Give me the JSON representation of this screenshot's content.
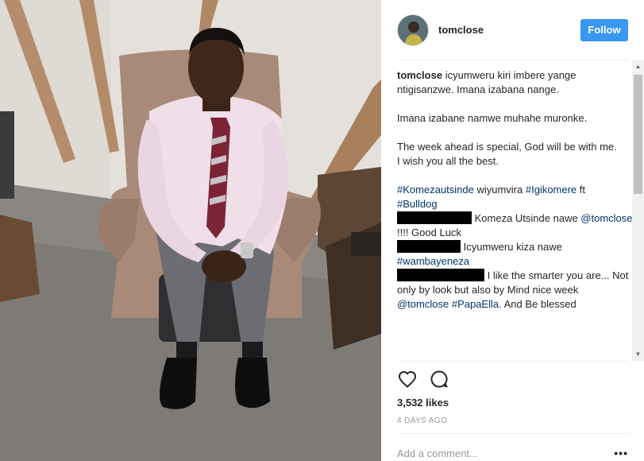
{
  "post": {
    "username": "tomclose",
    "follow_label": "Follow",
    "caption": {
      "lines": [
        "icyumweru kiri imbere yange ntigisanzwe. Imana izabana nange.",
        "Imana izabane namwe muhahe muronke.",
        "The week ahead is special, God will be with me.",
        "I wish you all the best."
      ],
      "hashtag_1": "#Komezautsinde",
      "hashtag_text": " wiyumvira ",
      "hashtag_2": "#Igikomere",
      "hashtag_ft": " ft",
      "hashtag_3": "#Bulldog"
    },
    "comments": [
      {
        "text_1": " Komeza Utsinde nawe ",
        "mention": "@tomclose",
        "text_2": " !!!! Good Luck"
      },
      {
        "text_1": " Icyumweru kiza nawe ",
        "tag": "#wambayeneza"
      },
      {
        "text_1": " I like the smarter you are... Not only by look but also by Mind nice week ",
        "mention": "@tomclose",
        "text_mid": " ",
        "tag": "#PapaElla",
        "text_2": ". And Be blessed"
      }
    ],
    "likes": "3,532 likes",
    "timestamp": "4 DAYS AGO",
    "comment_placeholder": "Add a comment...",
    "more_label": "•••"
  },
  "icons": {
    "like": "heart-icon",
    "comment": "comment-bubble-icon",
    "scroll_up": "scroll-up-arrow-icon",
    "scroll_down": "scroll-down-arrow-icon"
  },
  "colors": {
    "follow_button": "#3897f0",
    "hashtag": "#003569",
    "redaction": "#000000"
  }
}
